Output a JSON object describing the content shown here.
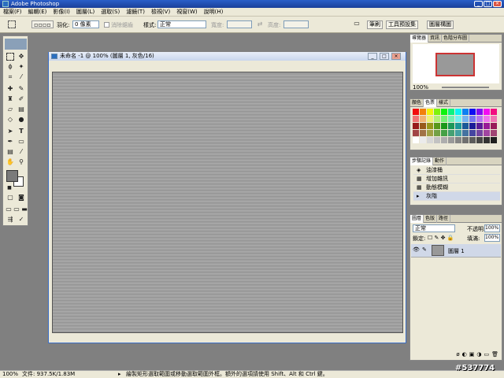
{
  "app": {
    "title": "Adobe Photoshop"
  },
  "menu": [
    "檔案(F)",
    "編輯(E)",
    "影像(I)",
    "圖層(L)",
    "選取(S)",
    "濾鏡(T)",
    "檢視(V)",
    "視窗(W)",
    "說明(H)"
  ],
  "options": {
    "feather_label": "羽化:",
    "feather_value": "0 像素",
    "antialias_label": "消除鋸齒",
    "style_label": "樣式:",
    "style_value": "正常",
    "width_label": "寬度:",
    "height_label": "高度:",
    "tab_brushes": "筆刷",
    "tab_presets": "工具預設集",
    "tab_comps": "圖層構圖"
  },
  "document": {
    "title": "未命名 -1 @ 100% (圖層 1, 灰色/16)"
  },
  "navigator": {
    "tabs": [
      "導覽器",
      "資訊",
      "色階分布圖"
    ],
    "zoom": "100%"
  },
  "color": {
    "tabs": [
      "顏色",
      "色票",
      "樣式"
    ]
  },
  "history": {
    "tabs": [
      "步驟記錄",
      "動作"
    ],
    "items": [
      "油漆桶",
      "增加雜訊",
      "動態模糊",
      "灰階"
    ]
  },
  "layers": {
    "tabs": [
      "圖層",
      "色版",
      "路徑"
    ],
    "blend": "正常",
    "opacity_label": "不透明:",
    "opacity": "100%",
    "lock_label": "鎖定:",
    "fill_label": "填滿:",
    "fill": "100%",
    "layer_name": "圖層 1"
  },
  "status": {
    "zoom": "100%",
    "doc": "文件: 937.5K/1.83M",
    "hint": "繪製矩形選取範圍或移動選取範圍外框。額外的選項請使用 Shift、Alt 和 Ctrl 鍵。"
  },
  "watermark": "#537774"
}
